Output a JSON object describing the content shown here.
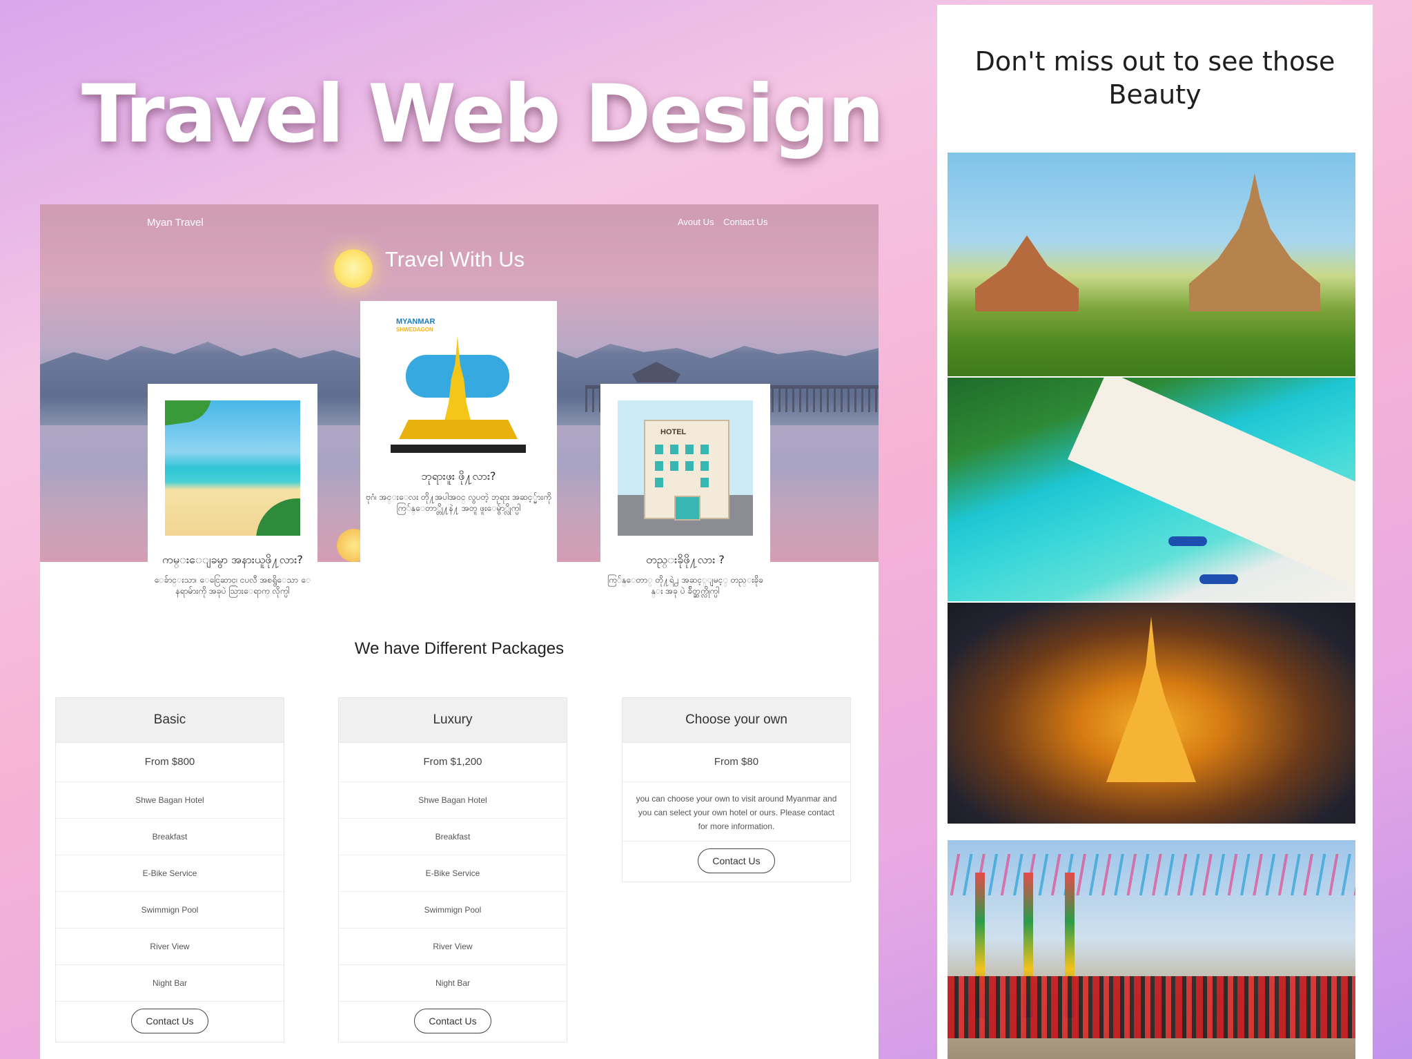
{
  "shot_title": "Travel Web Design",
  "site": {
    "brand": "Myan Travel",
    "nav": [
      {
        "label": "Avout Us"
      },
      {
        "label": "Contact Us"
      }
    ],
    "hero_title": "Travel With Us",
    "cards": [
      {
        "title": "ကမ္းေျခမွာ အနားယူဖို႔လား?",
        "desc": "ေခ်ာင္းသာ၊ ေငြေဆာင္၊ ငပလီ အစရွိေသာ ေနရာမ်ားကို အခုပဲ သြားေရာက္ လိုက္ပါ"
      },
      {
        "title": "ဘုရားဖူး ဖို႔လား?",
        "desc": "ဗုဂံ၊ အင္းေလး တို႔အပါအ၀င္ လွပတဲ့ ဘုရား အဆင့္မ်ားကို ကြ်န္ေတာ္တို႔နဲ႔ အတူ ဖူးေမွ်ာ္လိုက္ပါ"
      },
      {
        "title": "တည္းခိုဖို႔လား ?",
        "desc": "ကြ်န္ေတာ္ တို႔ရဲ႕ အဆင့္ျမင့္ တည္းခိုခန္း အခု ပဲ ခ်ိတ္ဆက္လိုက္ပါ"
      }
    ],
    "pagoda_art": {
      "line1": "MYANMAR",
      "line2": "SHWEDAGON"
    },
    "hotel_art": {
      "sign": "HOTEL"
    },
    "packages_heading": "We have Different Packages",
    "packages": [
      {
        "name": "Basic",
        "price": "From $800",
        "features": [
          "Shwe Bagan Hotel",
          "Breakfast",
          "E-Bike Service",
          "Swimmign Pool",
          "River View",
          "Night Bar"
        ],
        "button": "Contact Us"
      },
      {
        "name": "Luxury",
        "price": "From $1,200",
        "features": [
          "Shwe Bagan Hotel",
          "Breakfast",
          "E-Bike Service",
          "Swimmign Pool",
          "River View",
          "Night Bar"
        ],
        "button": "Contact Us"
      },
      {
        "name": "Choose your own",
        "price": "From $80",
        "description": "you can choose your own to visit around Myanmar and you can select your own hotel or ours. Please contact for more information.",
        "button": "Contact Us"
      }
    ]
  },
  "panel": {
    "title": "Don't miss out to see those Beauty",
    "photos": [
      "bagan-temples-photo",
      "tropical-beach-photo",
      "shwedagon-pagoda-night-photo",
      "festival-dance-photo"
    ]
  },
  "colors": {
    "accent_white": "#ffffff",
    "header_gray": "#f0f0f0",
    "text_dark": "#222222"
  }
}
